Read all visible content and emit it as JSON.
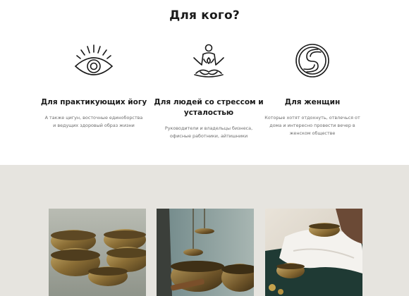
{
  "section_title": "Для кого?",
  "audiences": [
    {
      "icon": "eye-icon",
      "heading": "Для практикующих йогу",
      "text": "А также цигун, восточные единоборства и ведущих здоровый образ жизни"
    },
    {
      "icon": "meditation-icon",
      "heading": "Для людей со стрессом и усталостью",
      "text": "Руководители и владельцы бизнеса, офисные работники, айтишники"
    },
    {
      "icon": "yin-yang-icon",
      "heading": "Для женщин",
      "text": "Которые хотят отдохнуть, отвлечься от дома и интересно провести вечер в женском обществе"
    }
  ],
  "colors": {
    "background_top": "#ffffff",
    "background_bottom": "#e6e4df",
    "text": "#1a1a1a",
    "muted_text": "#6d6d6d"
  }
}
